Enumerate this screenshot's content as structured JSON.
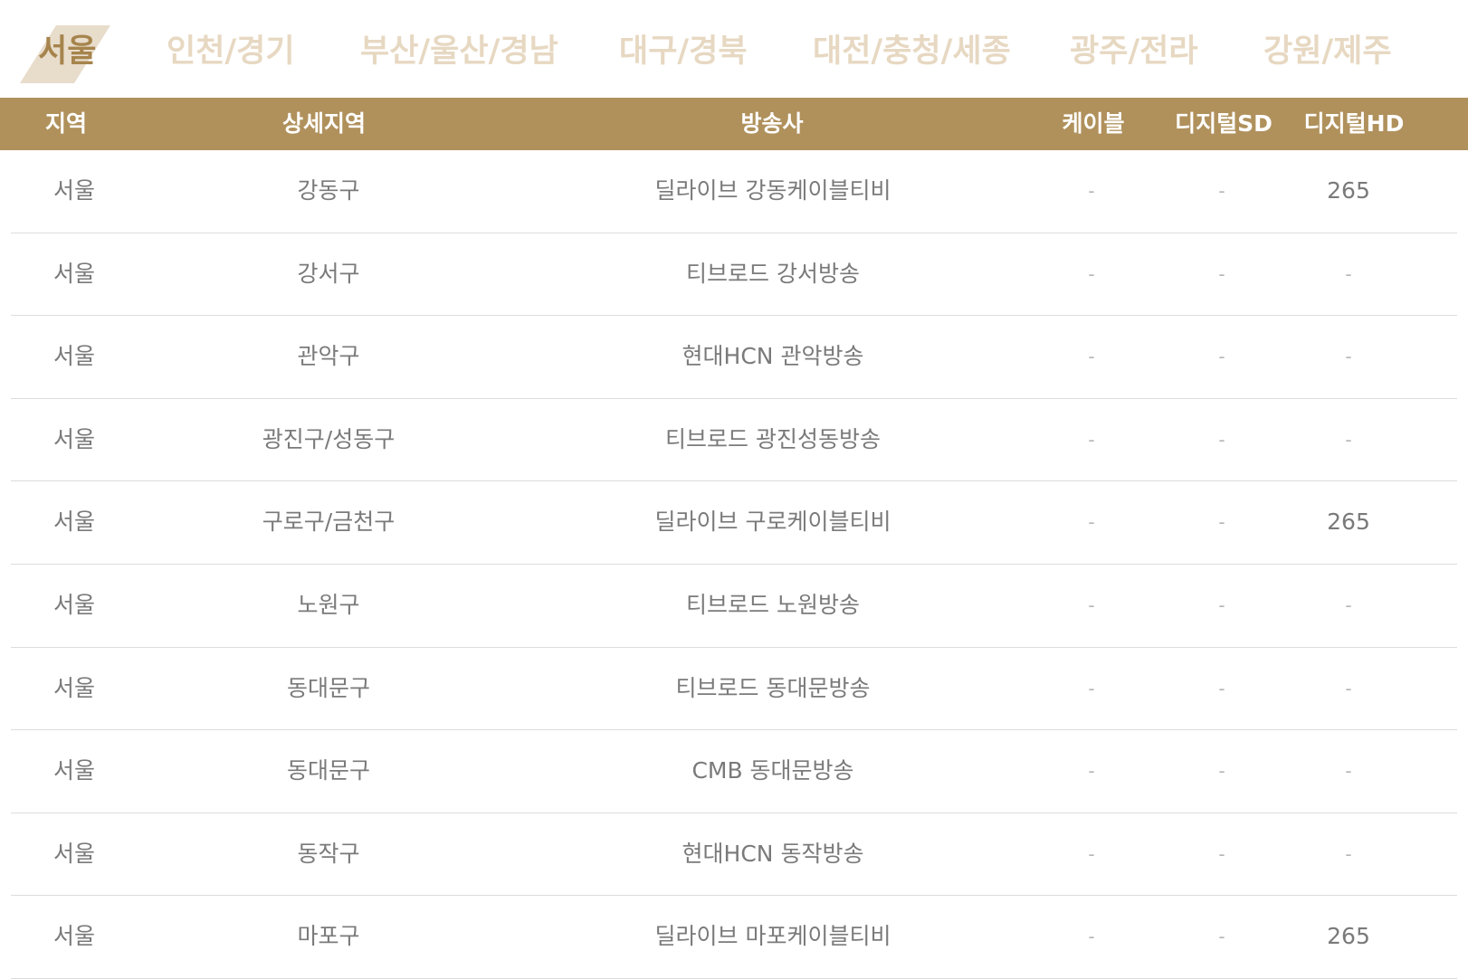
{
  "tabs": [
    {
      "label": "서울",
      "active": true
    },
    {
      "label": "인천/경기",
      "active": false
    },
    {
      "label": "부산/울산/경남",
      "active": false
    },
    {
      "label": "대구/경북",
      "active": false
    },
    {
      "label": "대전/충청/세종",
      "active": false
    },
    {
      "label": "광주/전라",
      "active": false
    },
    {
      "label": "강원/제주",
      "active": false
    }
  ],
  "table": {
    "headers": [
      "지역",
      "상세지역",
      "방송사",
      "케이블",
      "디지털SD",
      "디지털HD"
    ],
    "rows": [
      [
        "서울",
        "강동구",
        "딜라이브 강동케이블티비",
        "-",
        "-",
        "265"
      ],
      [
        "서울",
        "강서구",
        "티브로드 강서방송",
        "-",
        "-",
        "-"
      ],
      [
        "서울",
        "관악구",
        "현대HCN 관악방송",
        "-",
        "-",
        "-"
      ],
      [
        "서울",
        "광진구/성동구",
        "티브로드 광진성동방송",
        "-",
        "-",
        "-"
      ],
      [
        "서울",
        "구로구/금천구",
        "딜라이브 구로케이블티비",
        "-",
        "-",
        "265"
      ],
      [
        "서울",
        "노원구",
        "티브로드 노원방송",
        "-",
        "-",
        "-"
      ],
      [
        "서울",
        "동대문구",
        "티브로드 동대문방송",
        "-",
        "-",
        "-"
      ],
      [
        "서울",
        "동대문구",
        "CMB 동대문방송",
        "-",
        "-",
        "-"
      ],
      [
        "서울",
        "동작구",
        "현대HCN 동작방송",
        "-",
        "-",
        "-"
      ],
      [
        "서울",
        "마포구",
        "딜라이브 마포케이블티비",
        "-",
        "-",
        "265"
      ]
    ]
  },
  "colors": {
    "accent": "#b0915c",
    "active_tab": "#a6844c",
    "inactive_tab": "#e7d8c2",
    "tab_decoration": "#e8dccb"
  }
}
